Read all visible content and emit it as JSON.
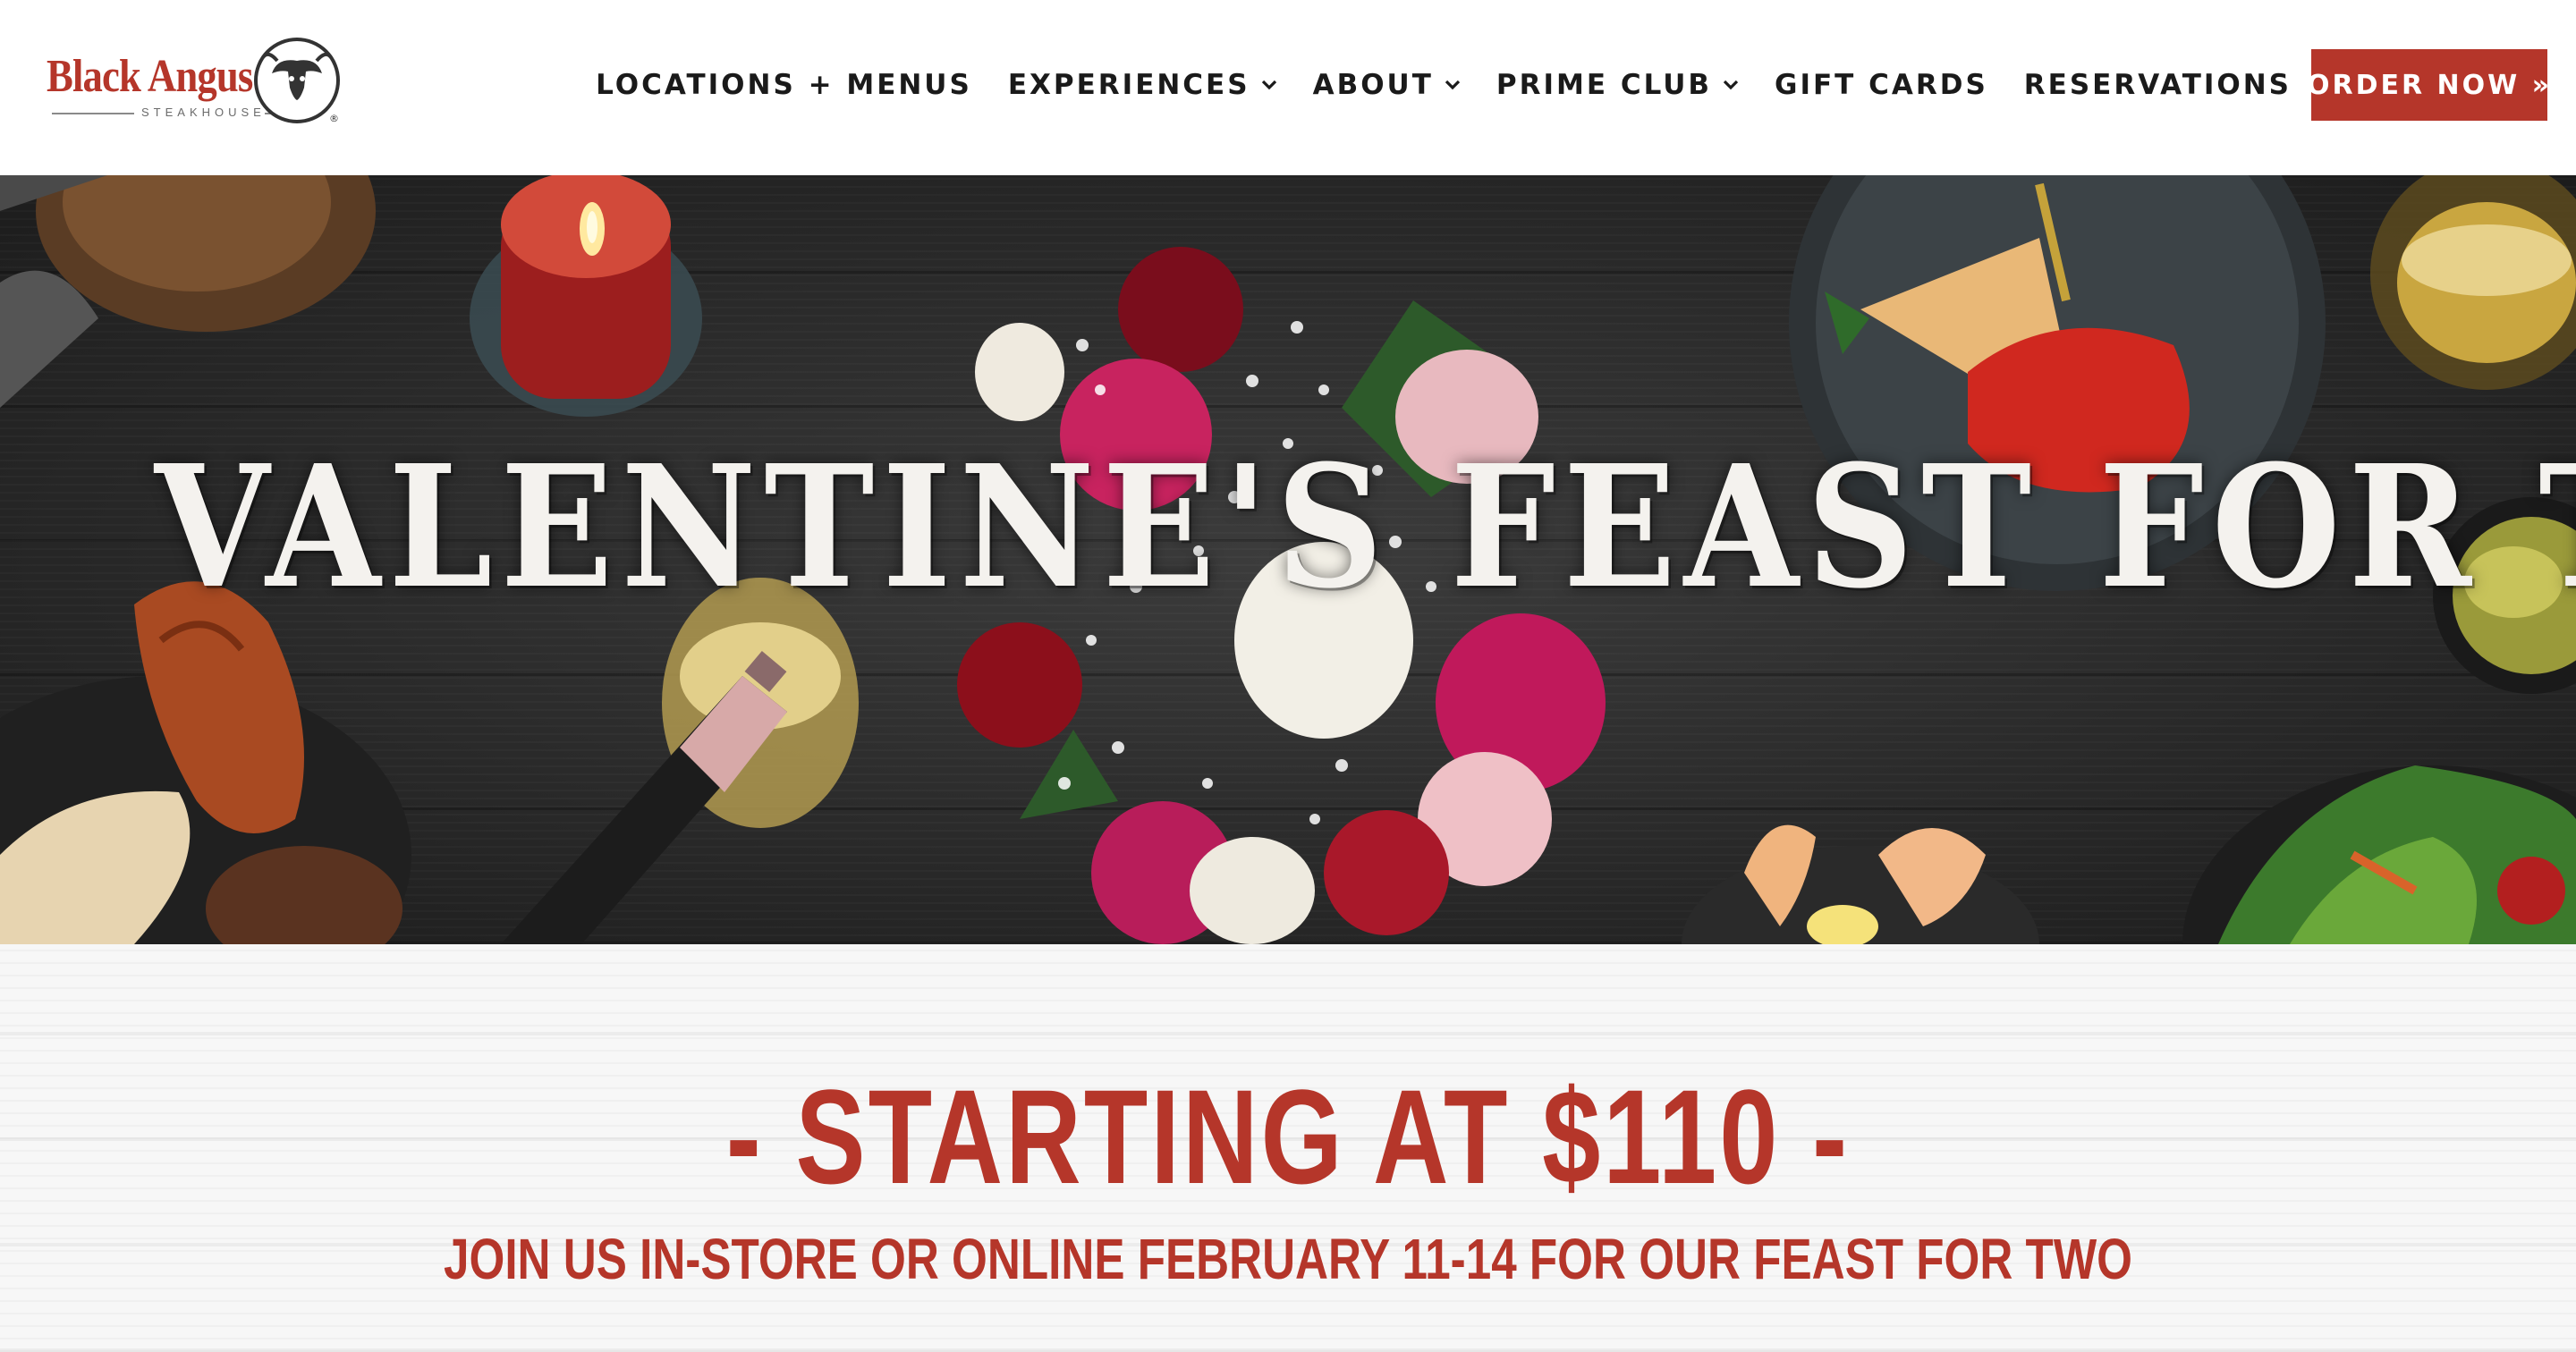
{
  "brand": {
    "name": "Black Angus",
    "tagline": "STEAKHOUSE",
    "colors": {
      "primary_red": "#b5362a",
      "nav_text": "#1a1a1a",
      "hero_bg": "#2a2a2a"
    }
  },
  "nav": {
    "items": [
      {
        "label": "LOCATIONS + MENUS",
        "dropdown": false
      },
      {
        "label": "EXPERIENCES",
        "dropdown": true
      },
      {
        "label": "ABOUT",
        "dropdown": true
      },
      {
        "label": "PRIME CLUB",
        "dropdown": true
      },
      {
        "label": "GIFT CARDS",
        "dropdown": false
      },
      {
        "label": "RESERVATIONS",
        "dropdown": false
      }
    ],
    "cta_label": "ORDER NOW »"
  },
  "hero": {
    "title": "VALENTINE'S FEAST FOR TWO"
  },
  "promo": {
    "price_line": "- STARTING AT $110 -",
    "subtitle": "JOIN US IN-STORE OR ONLINE FEBRUARY 11-14 FOR OUR FEAST FOR TWO"
  },
  "icons": {
    "logo_mark": "bull-cowboy-icon",
    "dropdown": "chevron-down-icon"
  }
}
